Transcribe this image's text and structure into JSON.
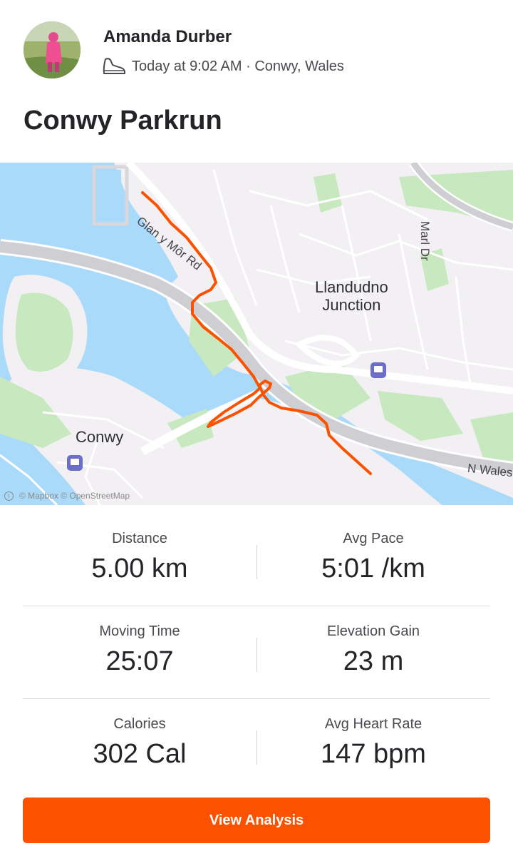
{
  "header": {
    "athlete_name": "Amanda Durber",
    "activity_icon": "shoe-icon",
    "meta": "Today at 9:02 AM · Conwy, Wales",
    "title": "Conwy Parkrun"
  },
  "map": {
    "labels": {
      "town_east": "Llandudno\nJunction",
      "town_west": "Conwy",
      "road_1": "Glan y Môr Rd",
      "road_2": "Marl Dr",
      "road_3": "N Wales"
    },
    "attribution": "© Mapbox © OpenStreetMap",
    "route_color": "#fc5200"
  },
  "stats": [
    {
      "label": "Distance",
      "value": "5.00 km"
    },
    {
      "label": "Avg Pace",
      "value": "5:01 /km"
    },
    {
      "label": "Moving Time",
      "value": "25:07"
    },
    {
      "label": "Elevation Gain",
      "value": "23 m"
    },
    {
      "label": "Calories",
      "value": "302 Cal"
    },
    {
      "label": "Avg Heart Rate",
      "value": "147 bpm"
    }
  ],
  "actions": {
    "view_analysis": "View Analysis"
  },
  "colors": {
    "accent": "#fc5200",
    "water": "#aadafa",
    "park": "#c8e8c0"
  }
}
